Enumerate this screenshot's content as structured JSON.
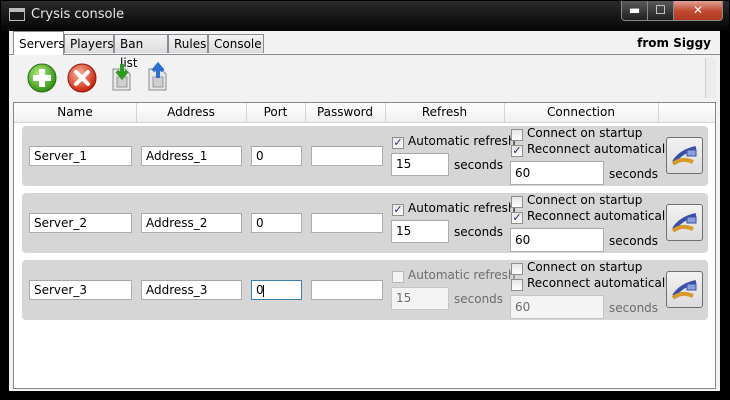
{
  "window": {
    "title": "Crysis console",
    "minimize": "▬",
    "maximize": "☐",
    "close": "✕"
  },
  "tabs": [
    "Servers",
    "Players",
    "Ban list",
    "Rules",
    "Console"
  ],
  "author": "from Siggy",
  "toolbar": {
    "icons": [
      "add-icon",
      "delete-icon",
      "import-icon",
      "export-icon"
    ]
  },
  "columns": [
    "Name",
    "Address",
    "Port",
    "Password",
    "Refresh",
    "Connection"
  ],
  "servers": [
    {
      "name": "Server_1",
      "address": "Address_1",
      "port": "0",
      "password": "",
      "auto_refresh_label": "Automatic refresh",
      "auto_refresh": true,
      "refresh_seconds": "15",
      "seconds_label": "seconds",
      "connect_startup_label": "Connect on startup",
      "connect_startup": false,
      "reconnect_label": "Reconnect automatically",
      "reconnect": true,
      "reconnect_seconds": "60"
    },
    {
      "name": "Server_2",
      "address": "Address_2",
      "port": "0",
      "password": "",
      "auto_refresh_label": "Automatic refresh",
      "auto_refresh": true,
      "refresh_seconds": "15",
      "seconds_label": "seconds",
      "connect_startup_label": "Connect on startup",
      "connect_startup": false,
      "reconnect_label": "Reconnect automatically",
      "reconnect": true,
      "reconnect_seconds": "60"
    },
    {
      "name": "Server_3",
      "address": "Address_3",
      "port": "0",
      "password": "",
      "auto_refresh_label": "Automatic refresh",
      "auto_refresh": false,
      "refresh_seconds": "15",
      "seconds_label": "seconds",
      "connect_startup_label": "Connect on startup",
      "connect_startup": false,
      "reconnect_label": "Reconnect automatically",
      "reconnect": false,
      "reconnect_seconds": "60"
    }
  ],
  "colors": {
    "close_button": "#c1472f",
    "row_background": "#d6d6d6",
    "focus_border": "#3c7fb1"
  }
}
